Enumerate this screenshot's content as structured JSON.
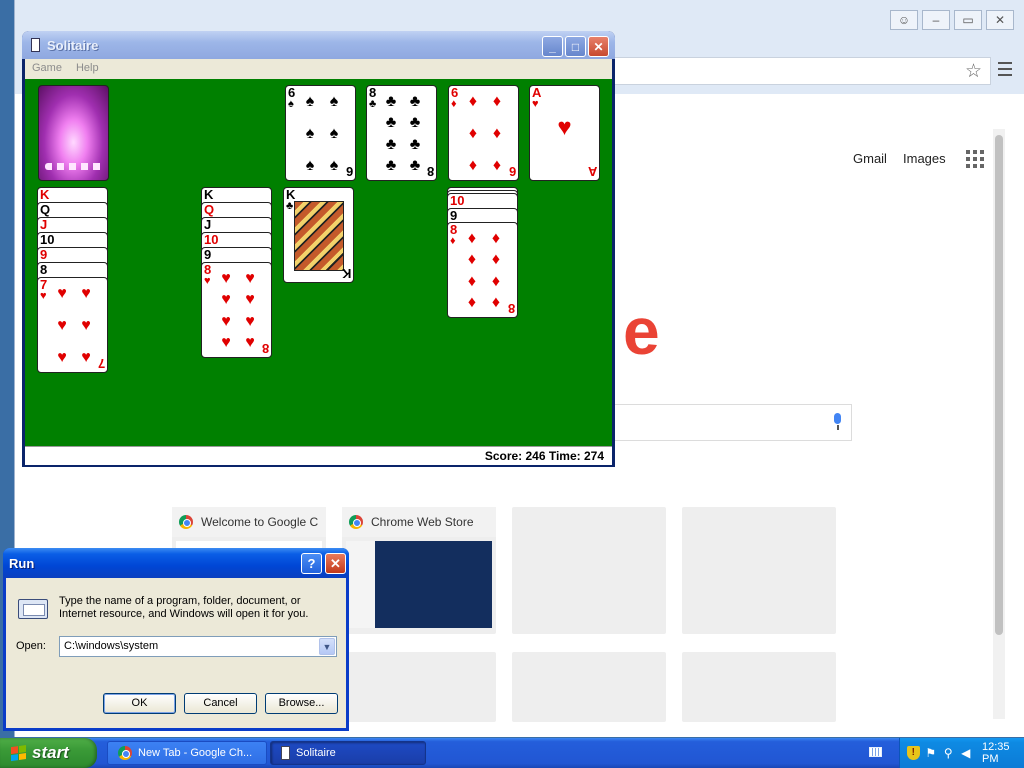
{
  "colors": {
    "felt": "#008000",
    "xp_blue": "#0046d5",
    "start_green": "#3a9a37",
    "card_red": "#e00000"
  },
  "chrome": {
    "top_links": [
      "Gmail",
      "Images"
    ],
    "logo_fragment": "e",
    "tiles": [
      {
        "title": "Welcome to Google C"
      },
      {
        "title": "Chrome Web Store"
      }
    ],
    "icons": {
      "bookmark": "star-icon",
      "menu": "hamburger-menu-icon",
      "apps": "apps-grid-icon",
      "voice": "microphone-icon"
    }
  },
  "solitaire": {
    "title": "Solitaire",
    "menu": [
      "Game",
      "Help"
    ],
    "status": "Score: 246 Time: 274",
    "foundations": [
      {
        "rank": "6",
        "suit": "♠",
        "color": "blk"
      },
      {
        "rank": "8",
        "suit": "♣",
        "color": "blk"
      },
      {
        "rank": "6",
        "suit": "♦",
        "color": "red"
      },
      {
        "rank": "A",
        "suit": "♥",
        "color": "red"
      }
    ],
    "tableau": [
      {
        "cards": [
          {
            "rank": "K",
            "suit": "♥"
          },
          {
            "rank": "Q",
            "suit": "♣"
          },
          {
            "rank": "J",
            "suit": "♥"
          },
          {
            "rank": "10",
            "suit": "♠"
          },
          {
            "rank": "9",
            "suit": "♥"
          },
          {
            "rank": "8",
            "suit": "♠"
          },
          {
            "rank": "7",
            "suit": "♥"
          }
        ]
      },
      {
        "cards": [
          {
            "rank": "K",
            "suit": "♠"
          },
          {
            "rank": "Q",
            "suit": "♥"
          },
          {
            "rank": "J",
            "suit": "♠"
          },
          {
            "rank": "10",
            "suit": "♥"
          },
          {
            "rank": "9",
            "suit": "♠"
          },
          {
            "rank": "8",
            "suit": "♥"
          }
        ]
      },
      {
        "cards": [
          {
            "rank": "K",
            "suit": "♣"
          }
        ]
      },
      {
        "cards": [
          {
            "rank": "10",
            "suit": "♦"
          },
          {
            "rank": "9",
            "suit": "♠"
          },
          {
            "rank": "8",
            "suit": "♦"
          }
        ]
      }
    ]
  },
  "run": {
    "title": "Run",
    "description": "Type the name of a program, folder, document, or Internet resource, and Windows will open it for you.",
    "open_label": "Open:",
    "open_value": "C:\\windows\\system",
    "buttons": {
      "ok": "OK",
      "cancel": "Cancel",
      "browse": "Browse..."
    }
  },
  "taskbar": {
    "start": "start",
    "tasks": [
      "New Tab - Google Ch...",
      "Solitaire"
    ],
    "clock": "12:35 PM"
  }
}
